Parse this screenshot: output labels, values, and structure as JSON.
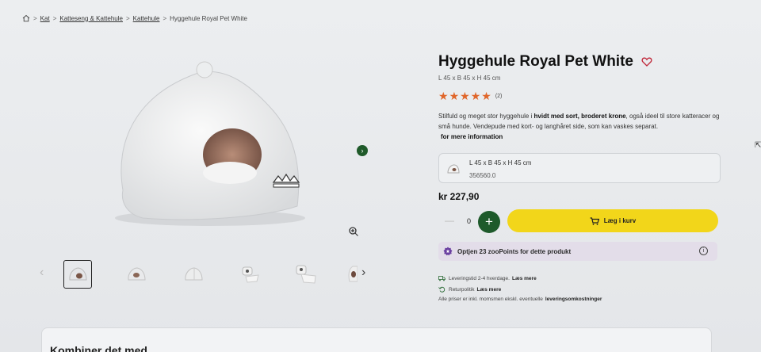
{
  "breadcrumb": {
    "items": [
      "Kat",
      "Katteseng & Kattehule",
      "Kattehule"
    ],
    "current": "Hyggehule Royal Pet White"
  },
  "product": {
    "title": "Hyggehule Royal Pet White",
    "dimensions": "L 45 x B 45 x H 45 cm",
    "rating": {
      "stars": 5,
      "count": "(2)"
    },
    "description_parts": {
      "p1": "Stilfuld og meget stor hyggehule i ",
      "bold": "hvidt med sort, broderet krone",
      "p2": ", også ideel til store katteracer og små hunde. Vendepude med kort- og langhåret side, som kan vaskes separat."
    },
    "more_info": "for mere information"
  },
  "variant": {
    "name": "L 45 x B 45 x H 45 cm",
    "sku": "356560.0"
  },
  "price": "kr 227,90",
  "quantity": {
    "minus": "—",
    "value": "0",
    "plus": "+"
  },
  "cart_button": "Læg i kurv",
  "points": {
    "text": "Optjen 23 zooPoints for dette produkt",
    "info": "i"
  },
  "shipping": {
    "delivery": "Leveringstid 2-4 hverdage.",
    "delivery_link": "Læs mere",
    "returns": "Returpolitik",
    "returns_link": "Læs mere",
    "prices_note": "Alle priser er inkl. momsmen ekskl. eventuelle",
    "prices_link": "leveringsomkostninger"
  },
  "combine_section": {
    "title": "Kombiner det med"
  },
  "colors": {
    "accent_green": "#1e5a2b",
    "cart_yellow": "#f2d61a",
    "star_orange": "#e0662a",
    "points_bg": "#e3dde9"
  }
}
